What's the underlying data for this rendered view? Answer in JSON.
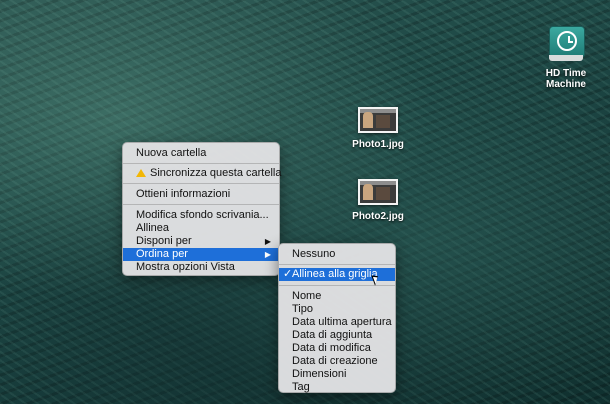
{
  "desktop": {
    "icons": [
      {
        "label": "HD Time Machine",
        "icon": "time-machine-drive-icon"
      },
      {
        "label": "Photo1.jpg",
        "icon": "photo-thumbnail-icon"
      },
      {
        "label": "Photo2.jpg",
        "icon": "photo-thumbnail-icon"
      }
    ]
  },
  "context_menu": {
    "items": [
      "Nuova cartella",
      "Sincronizza questa cartella",
      "Ottieni informazioni",
      "Modifica sfondo scrivania...",
      "Allinea",
      "Disponi per",
      "Ordina per",
      "Mostra opzioni Vista"
    ],
    "submenu_arrow": "▶"
  },
  "submenu": {
    "none": "Nessuno",
    "check": "✓",
    "snap": "Allinea alla griglia",
    "sort_items": [
      "Nome",
      "Tipo",
      "Data ultima apertura",
      "Data di aggiunta",
      "Data di modifica",
      "Data di creazione",
      "Dimensioni",
      "Tag"
    ]
  },
  "colors": {
    "highlight": "#1e6fd9",
    "menu_bg": "#e2e2e4"
  }
}
